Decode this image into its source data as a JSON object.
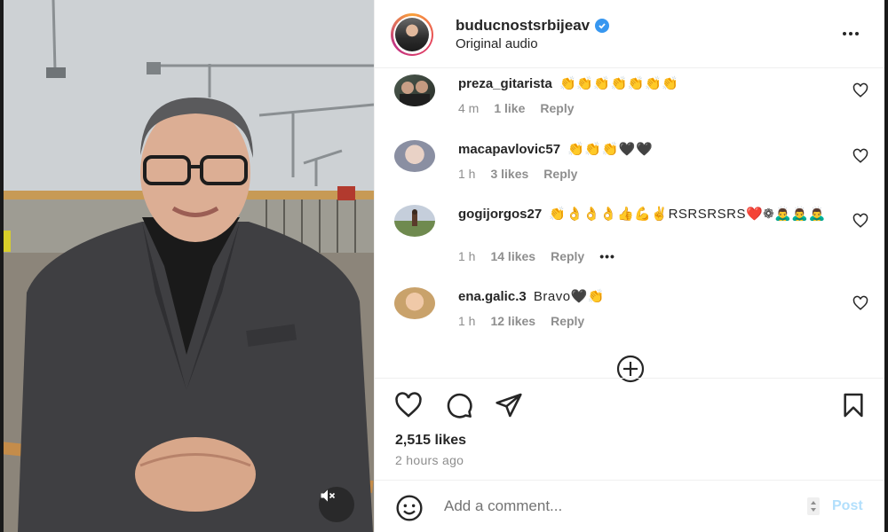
{
  "post": {
    "username": "buducnostsrbijeav",
    "subtitle": "Original audio",
    "icons": {
      "verified": "verified-badge-icon",
      "more": "more-options-icon",
      "mute": "speaker-muted-icon"
    }
  },
  "comments": [
    {
      "username": "preza_gitarista",
      "text": "👏👏👏👏👏👏👏",
      "time": "4 m",
      "likes": "1 like",
      "reply": "Reply"
    },
    {
      "username": "macapavlovic57",
      "text": "👏👏👏🖤🖤",
      "time": "1 h",
      "likes": "3 likes",
      "reply": "Reply"
    },
    {
      "username": "gogijorgos27",
      "text": "👏👌👌👌👍💪✌RSRSRSRS❤️❁🙇‍♂️🙇‍♂️🙇‍♂️",
      "time": "1 h",
      "likes": "14 likes",
      "reply": "Reply",
      "more": "•••"
    },
    {
      "username": "ena.galic.3",
      "text": "Bravo🖤👏",
      "time": "1 h",
      "likes": "12 likes",
      "reply": "Reply"
    }
  ],
  "actions": {
    "likes": "2,515 likes",
    "time": "2 hours ago"
  },
  "composer": {
    "placeholder": "Add a comment...",
    "post_label": "Post"
  },
  "colors": {
    "verified": "#3797f0",
    "post_disabled": "#b2dffc",
    "meta": "#8e8e8e",
    "text": "#262626"
  }
}
